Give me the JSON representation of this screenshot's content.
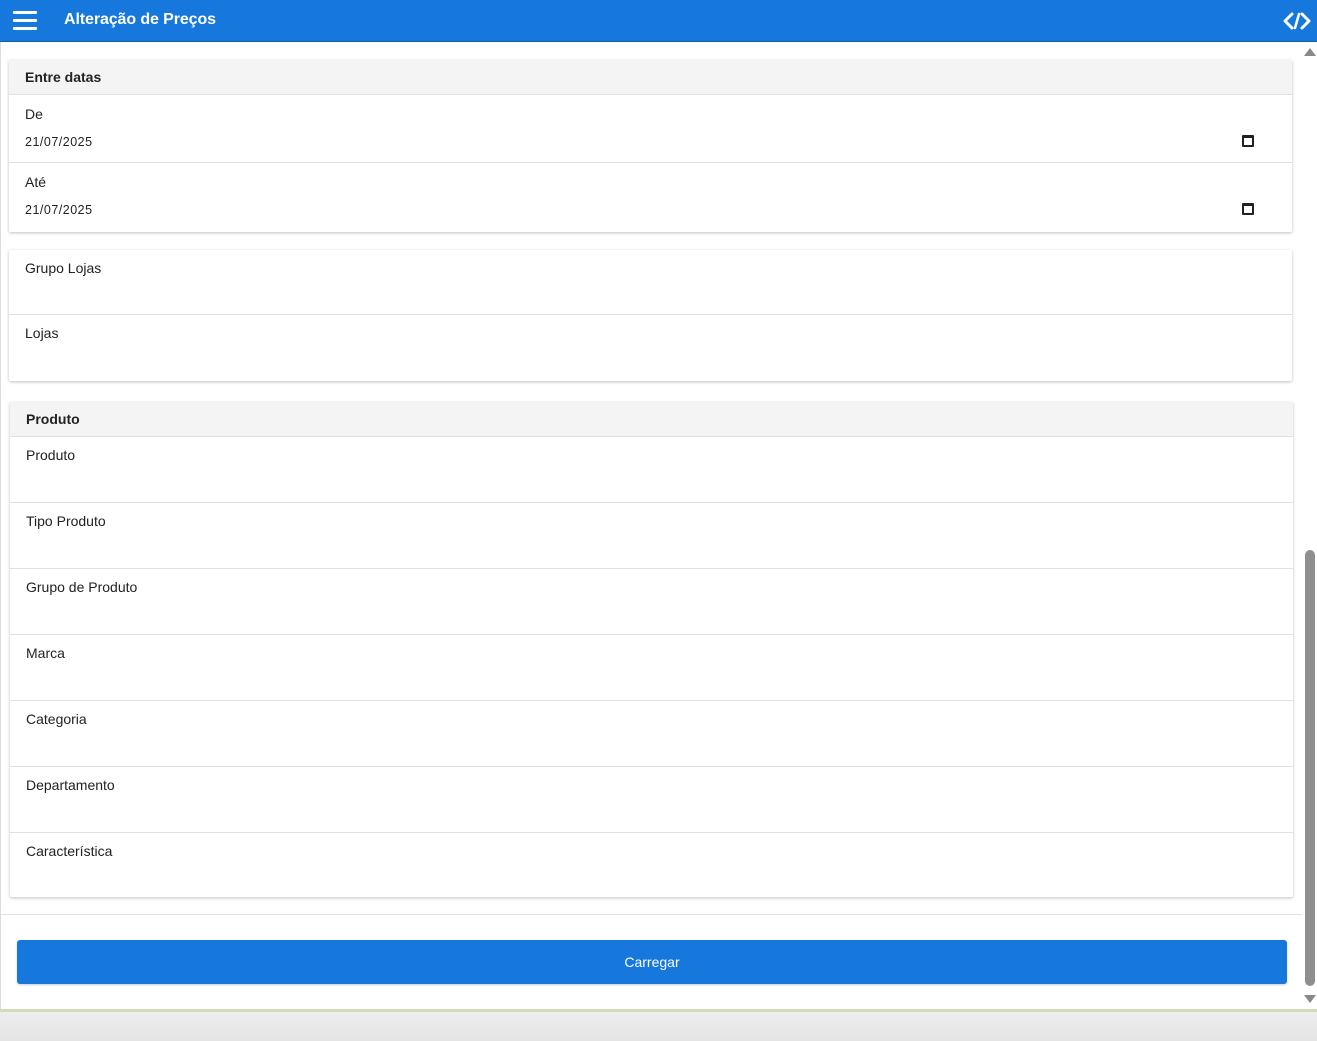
{
  "header": {
    "title": "Alteração de Preços",
    "menu_icon": "hamburger-menu-icon",
    "code_icon": "code-brackets-icon"
  },
  "dates": {
    "section_title": "Entre datas",
    "from_label": "De",
    "from_value": "21/07/2025",
    "to_label": "Até",
    "to_value": "21/07/2025"
  },
  "stores": {
    "group_label": "Grupo Lojas",
    "stores_label": "Lojas"
  },
  "product": {
    "section_title": "Produto",
    "fields": [
      "Produto",
      "Tipo Produto",
      "Grupo de Produto",
      "Marca",
      "Categoria",
      "Departamento",
      "Característica"
    ]
  },
  "actions": {
    "load_label": "Carregar"
  },
  "colors": {
    "primary": "#1677dd",
    "header_bg": "#f4f4f4"
  }
}
